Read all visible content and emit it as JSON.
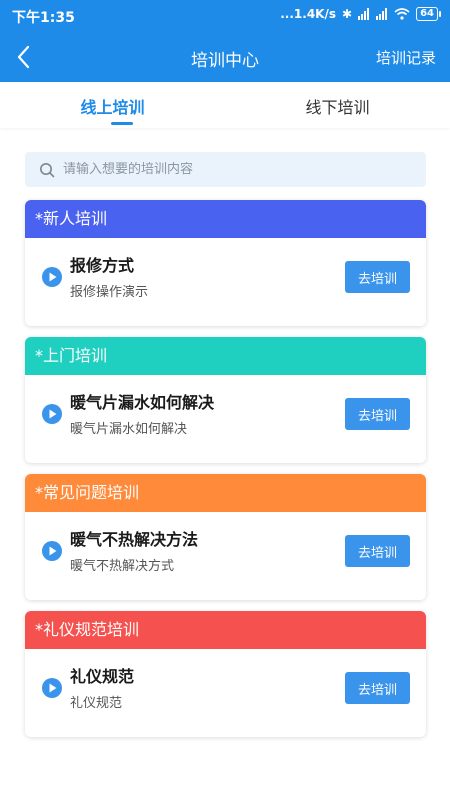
{
  "status_bar": {
    "time": "下午1:35",
    "network_speed": "...1.4K/s",
    "battery": "64"
  },
  "header": {
    "title": "培训中心",
    "records_label": "培训记录"
  },
  "tabs": [
    {
      "label": "线上培训",
      "active": true
    },
    {
      "label": "线下培训",
      "active": false
    }
  ],
  "search": {
    "placeholder": "请输入想要的培训内容",
    "value": ""
  },
  "sections": [
    {
      "heading": "*新人培训",
      "color": "#4a62f0",
      "item_title": "报修方式",
      "item_subtitle": "报修操作演示",
      "button_label": "去培训"
    },
    {
      "heading": "*上门培训",
      "color": "#1fcfbf",
      "item_title": "暖气片漏水如何解决",
      "item_subtitle": "暖气片漏水如何解决",
      "button_label": "去培训"
    },
    {
      "heading": "*常见问题培训",
      "color": "#ff8a3a",
      "item_title": "暖气不热解决方法",
      "item_subtitle": "暖气不热解决方式",
      "button_label": "去培训"
    },
    {
      "heading": "*礼仪规范培训",
      "color": "#f5524f",
      "item_title": "礼仪规范",
      "item_subtitle": "礼仪规范",
      "button_label": "去培训"
    }
  ],
  "colors": {
    "primary": "#1f8be8",
    "button": "#3a94ec",
    "search_bg": "#eaf3fc"
  },
  "icons": {
    "back": "chevron-left-icon",
    "search": "search-icon",
    "play": "play-circle-icon"
  }
}
